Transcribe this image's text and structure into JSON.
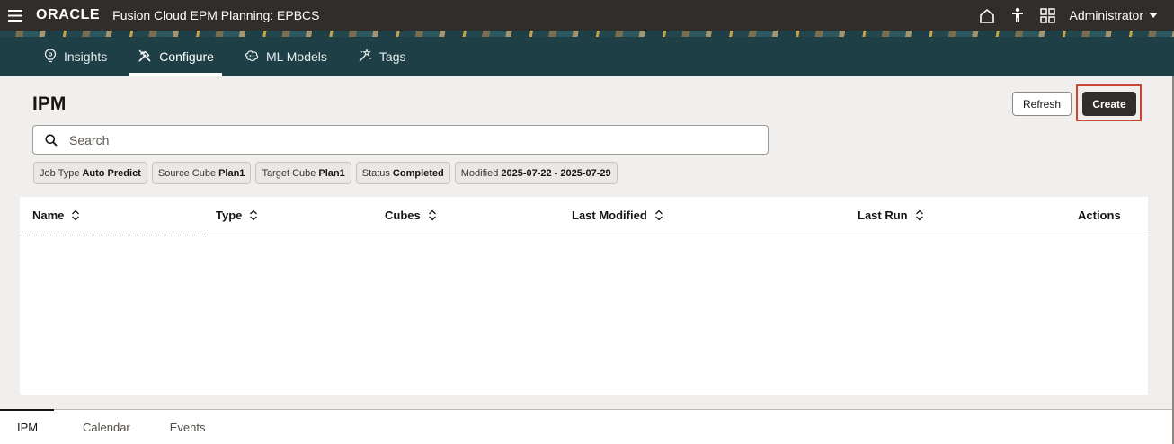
{
  "header": {
    "logo": "ORACLE",
    "app_title": "Fusion Cloud EPM Planning: EPBCS",
    "user": "Administrator"
  },
  "nav": {
    "tabs": [
      {
        "label": "Insights",
        "icon": "insights-icon"
      },
      {
        "label": "Configure",
        "icon": "configure-icon",
        "active": true
      },
      {
        "label": "ML Models",
        "icon": "ml-models-icon"
      },
      {
        "label": "Tags",
        "icon": "tags-icon"
      }
    ]
  },
  "page": {
    "title": "IPM",
    "refresh_label": "Refresh",
    "create_label": "Create"
  },
  "search": {
    "placeholder": "Search",
    "value": ""
  },
  "filters": [
    {
      "key": "Job Type",
      "value": "Auto Predict"
    },
    {
      "key": "Source Cube",
      "value": "Plan1"
    },
    {
      "key": "Target Cube",
      "value": "Plan1"
    },
    {
      "key": "Status",
      "value": "Completed"
    },
    {
      "key": "Modified",
      "value": "2025-07-22 - 2025-07-29"
    }
  ],
  "table": {
    "columns": [
      "Name",
      "Type",
      "Cubes",
      "Last Modified",
      "Last Run",
      "Actions"
    ],
    "rows": []
  },
  "bottom_tabs": [
    {
      "label": "IPM",
      "active": true
    },
    {
      "label": "Calendar"
    },
    {
      "label": "Events"
    }
  ],
  "colors": {
    "header_bg": "#312d2a",
    "nav_bg": "#1f3f46",
    "content_bg": "#f1efed",
    "highlight": "#c74634",
    "primary_button": "#312d2a"
  }
}
